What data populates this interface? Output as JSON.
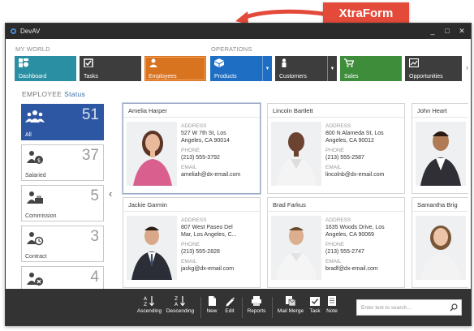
{
  "callout": {
    "text": "XtraForm"
  },
  "window": {
    "title": "DevAV",
    "buttons": [
      "_",
      "□",
      "✕"
    ]
  },
  "nav": {
    "group_my_world": "MY WORLD",
    "group_operations": "OPERATIONS",
    "tiles": [
      {
        "label": "Dashboard",
        "color": "#2a8fa3",
        "icon": "dashboard-icon"
      },
      {
        "label": "Tasks",
        "color": "#3d3d3d",
        "icon": "tasks-icon"
      },
      {
        "label": "Employees",
        "color": "#d8731f",
        "icon": "employees-icon"
      },
      {
        "label": "Products",
        "color": "#1e6fc4",
        "icon": "products-icon"
      },
      {
        "label": "Customers",
        "color": "#3d3d3d",
        "icon": "customers-icon"
      },
      {
        "label": "Sales",
        "color": "#3e8d3a",
        "icon": "sales-icon"
      },
      {
        "label": "Opportunities",
        "color": "#3d3d3d",
        "icon": "opportunities-icon"
      }
    ]
  },
  "left_panel": {
    "header": "EMPLOYEE",
    "status_link": "Status",
    "filters": [
      {
        "label": "All",
        "count": "51",
        "icon": "group-icon"
      },
      {
        "label": "Salaried",
        "count": "37",
        "icon": "salaried-icon"
      },
      {
        "label": "Commission",
        "count": "5",
        "icon": "commission-icon"
      },
      {
        "label": "Contract",
        "count": "3",
        "icon": "contract-icon"
      },
      {
        "label": "",
        "count": "4",
        "icon": "terminated-icon"
      }
    ]
  },
  "labels": {
    "address": "ADDRESS",
    "phone": "PHONE",
    "email": "EMAIL"
  },
  "cards": [
    {
      "name": "Amelia Harper",
      "address1": "527 W 7th St, Los",
      "address2": "Angeles, CA 90014",
      "phone": "(213) 555-3792",
      "email": "ameliah@dx-email.com"
    },
    {
      "name": "Lincoln Bartlett",
      "address1": "800 N Alameda St, Los",
      "address2": "Angeles, CA 90012",
      "phone": "(213) 555-2587",
      "email": "lincolnb@dx-email.com"
    },
    {
      "name": "John Heart"
    },
    {
      "name": "Jackie Garmin",
      "address1": "807 West Paseo Del",
      "address2": "Mar, Los Angeles, C...",
      "phone": "(213) 555-2828",
      "email": "jackg@dx-email.com"
    },
    {
      "name": "Brad Farkus",
      "address1": "1635 Woods Drive, Los",
      "address2": "Angeles, CA 90069",
      "phone": "(213) 555-2747",
      "email": "bradf@dx-email.com"
    },
    {
      "name": "Samantha Brig"
    }
  ],
  "toolbar": {
    "buttons": [
      {
        "label": "Ascending",
        "icon": "sort-ascending-icon"
      },
      {
        "label": "Descending",
        "icon": "sort-descending-icon"
      },
      {
        "label": "New",
        "icon": "new-document-icon"
      },
      {
        "label": "Edit",
        "icon": "edit-pencil-icon"
      },
      {
        "label": "Reports",
        "icon": "printer-icon"
      },
      {
        "label": "Mail Merge",
        "icon": "mail-merge-icon"
      },
      {
        "label": "Task",
        "icon": "task-checkbox-icon"
      },
      {
        "label": "Note",
        "icon": "note-icon"
      }
    ],
    "search_placeholder": "Enter text to search..."
  }
}
